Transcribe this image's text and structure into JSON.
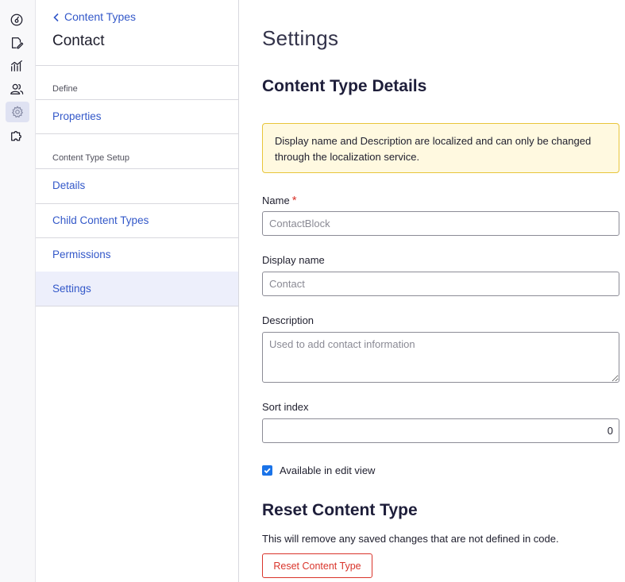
{
  "rail": {
    "icons": [
      "dashboard-icon",
      "edit-document-icon",
      "analytics-icon",
      "users-icon",
      "settings-icon",
      "addons-icon"
    ]
  },
  "nav": {
    "back_label": "Content Types",
    "title": "Contact",
    "define_section": "Define",
    "properties": "Properties",
    "setup_section": "Content Type Setup",
    "items": [
      {
        "label": "Details"
      },
      {
        "label": "Child Content Types"
      },
      {
        "label": "Permissions"
      },
      {
        "label": "Settings"
      }
    ]
  },
  "main": {
    "page_title": "Settings",
    "details_title": "Content Type Details",
    "notice": "Display name and Description are localized and can only be changed through the localization service.",
    "name_label": "Name",
    "name_required": "*",
    "name_placeholder": "ContactBlock",
    "display_name_label": "Display name",
    "display_name_placeholder": "Contact",
    "description_label": "Description",
    "description_placeholder": "Used to add contact information",
    "sort_index_label": "Sort index",
    "sort_index_value": "0",
    "available_label": "Available in edit view",
    "available_checked": true,
    "reset_title": "Reset Content Type",
    "reset_text": "This will remove any saved changes that are not defined in code.",
    "reset_button": "Reset Content Type"
  },
  "colors": {
    "accent": "#3358c9",
    "danger": "#d9342b",
    "notice_bg": "#fff9e0",
    "notice_border": "#e8c53a",
    "selected_bg": "#edeffb"
  }
}
